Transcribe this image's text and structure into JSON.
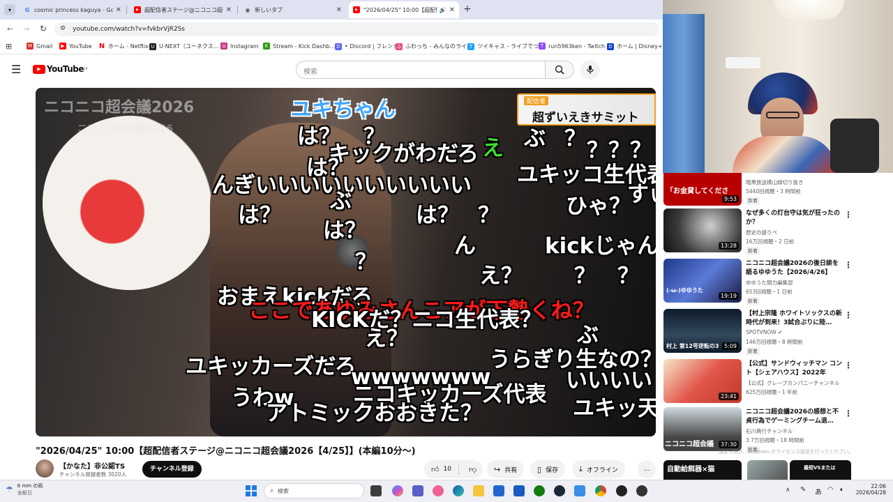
{
  "tabs": [
    {
      "label": "cosmic princess kaguya - Goog",
      "active": false
    },
    {
      "label": "超配信者ステージ@ニコニコ超会議",
      "active": false
    },
    {
      "label": "新しいタブ",
      "active": false
    },
    {
      "label": "\"2026/04/25\" 10:00【超配信",
      "active": true
    }
  ],
  "address": {
    "url": "youtube.com/watch?v=fvkbrVjR2Ss"
  },
  "bookmarks": [
    {
      "label": "Gmail",
      "color": "#d93025",
      "glyph": "M"
    },
    {
      "label": "YouTube",
      "color": "#ff0000",
      "glyph": "▶"
    },
    {
      "label": "ホーム - Netflix",
      "color": "#e50914",
      "glyph": "N"
    },
    {
      "label": "U-NEXT（ユーネクス…",
      "color": "#222222",
      "glyph": "U"
    },
    {
      "label": "Instagram",
      "color": "#c13584",
      "glyph": "◎"
    },
    {
      "label": "Stream - Kick Dashb…",
      "color": "#53fc18",
      "glyph": "K"
    },
    {
      "label": "• Discord | フレンド",
      "color": "#5865f2",
      "glyph": "D"
    },
    {
      "label": "ふわっち - みんなのライ…",
      "color": "#e84a7f",
      "glyph": "ふ"
    },
    {
      "label": "ツイキャス - ライブでつ…",
      "color": "#1da1f2",
      "glyph": "T"
    },
    {
      "label": "run5963ken - Twitch",
      "color": "#9146ff",
      "glyph": "T"
    },
    {
      "label": "ホーム | Disney+ (ディ…",
      "color": "#113ccf",
      "glyph": "D"
    }
  ],
  "youtube": {
    "logo": "YouTube",
    "region": "JP",
    "search_placeholder": "検索"
  },
  "video": {
    "top_label": "ユキちゃん",
    "corner_badge": "超ずいえきサミット",
    "corner_small": "配信者",
    "watermark": "ニコニコ超会議2026",
    "watermark2": "ニコニコ超会議2026",
    "comments": [
      {
        "text": "は？",
        "red": false
      },
      {
        "text": "？",
        "red": false
      },
      {
        "text": "キックがわだろ",
        "red": false
      },
      {
        "text": "え",
        "red": false
      },
      {
        "text": "ぶ",
        "red": false
      },
      {
        "text": "？",
        "red": false
      },
      {
        "text": "？？？",
        "red": false
      },
      {
        "text": "は？",
        "red": false
      },
      {
        "text": "ユキッコ生代表",
        "red": false
      },
      {
        "text": "んぎいいいいいいいいいい",
        "red": false
      },
      {
        "text": "ぶ",
        "red": false
      },
      {
        "text": "すぃ",
        "red": false
      },
      {
        "text": "ひゃ？",
        "red": false
      },
      {
        "text": "は？",
        "red": false
      },
      {
        "text": "は？",
        "red": false
      },
      {
        "text": "？",
        "red": false
      },
      {
        "text": "は？",
        "red": false
      },
      {
        "text": "ん",
        "red": false
      },
      {
        "text": "kickじゃん",
        "red": false
      },
      {
        "text": "？",
        "red": false
      },
      {
        "text": "え？",
        "red": false
      },
      {
        "text": "？",
        "red": false
      },
      {
        "text": "？",
        "red": false
      },
      {
        "text": "おまえkickだろ",
        "red": false
      },
      {
        "text": "ここであゆみさんこアが下勢くね？",
        "red": true
      },
      {
        "text": "KICKだ？ニコ生代表？",
        "red": false
      },
      {
        "text": "え？",
        "red": false
      },
      {
        "text": "ぶ",
        "red": false
      },
      {
        "text": "ユキッカーズだろ",
        "red": false
      },
      {
        "text": "うらぎり生なの？",
        "red": false
      },
      {
        "text": "wwwwwww",
        "red": false
      },
      {
        "text": "いいいい",
        "red": false
      },
      {
        "text": "うわw",
        "red": false
      },
      {
        "text": "ニコキッカーズ代表",
        "red": false
      },
      {
        "text": "ユキッ天",
        "red": false
      },
      {
        "text": "アトミックおおきた？",
        "red": false
      }
    ]
  },
  "video_title": "\"2026/04/25\" 10:00【超配信者ステージ@ニコニコ超会議2026【4/25】】(本編10分〜)",
  "channel": {
    "name": "【かなた】非公認TS",
    "subscribers": "チャンネル登録者数 3020人",
    "subscribe_label": "チャンネル登録"
  },
  "actions": {
    "likes": "10",
    "share": "共有",
    "save": "保存",
    "offline": "オフライン",
    "more": "…"
  },
  "sidebar": [
    {
      "title": "",
      "channel": "暗黒放送横山緑切り抜き",
      "meta": "5440回視聴・3 時間前",
      "badge": "新着",
      "duration": "9:53",
      "thumb_text": "「お金貸してくださ",
      "thumb_color": "#b80000"
    },
    {
      "title": "なぜ多くの灯台守は気が狂ったのか？",
      "channel": "歴史の語りベ",
      "meta": "16万回視聴・2 日前",
      "badge": "新着",
      "duration": "13:28",
      "thumb_text": "",
      "thumb_color": "#333333"
    },
    {
      "title": "ニコニコ超会議2026の後日談を語るゆゆうた【2026/4/26】",
      "channel": "ゆゆうた間力編集部",
      "meta": "653回視聴・1 日前",
      "badge": "新着",
      "duration": "19:19",
      "thumb_text": "(-ω-)ゆゆうた",
      "thumb_color": "#1e3a8a"
    },
    {
      "title": "【村上宗隆 ホワイトソックスの新時代が到来！3試合ぶりに陸…",
      "channel": "SPOTVNOW ✔",
      "meta": "146万回視聴・8 時間前",
      "badge": "新着",
      "duration": "5:09",
      "thumb_text": "村上 第12号逆転の3",
      "thumb_color": "#0d1b2a"
    },
    {
      "title": "【公式】サンドウィッチマン コント【シェアハウス】2022年",
      "channel": "【公式】グレープカンパニーチャンネル",
      "meta": "625万回視聴・1 年前",
      "badge": "",
      "duration": "23:41",
      "thumb_text": "",
      "thumb_color": "#c0392b"
    },
    {
      "title": "ニコニコ超会議2026の感想と不貞行為でゲーミングチーム退…",
      "channel": "石川典行チャンネル",
      "meta": "3.7万回視聴・18 時間前",
      "badge": "新着",
      "duration": "37:30",
      "thumb_text": "ニコニコ超会議",
      "thumb_color": "#444444"
    }
  ],
  "bottom_strip": {
    "label": "自動給餌器×猫",
    "label2": "最短VSまたは"
  },
  "windows_activation": "設定を開き、Windows のライセンス認証を行ってください。",
  "taskbar": {
    "weather_temp": "6 mm の雨",
    "weather_sub": "全般日",
    "search_placeholder": "検索",
    "time": "22:06",
    "date": "2026/04/28",
    "ime": "あ"
  }
}
